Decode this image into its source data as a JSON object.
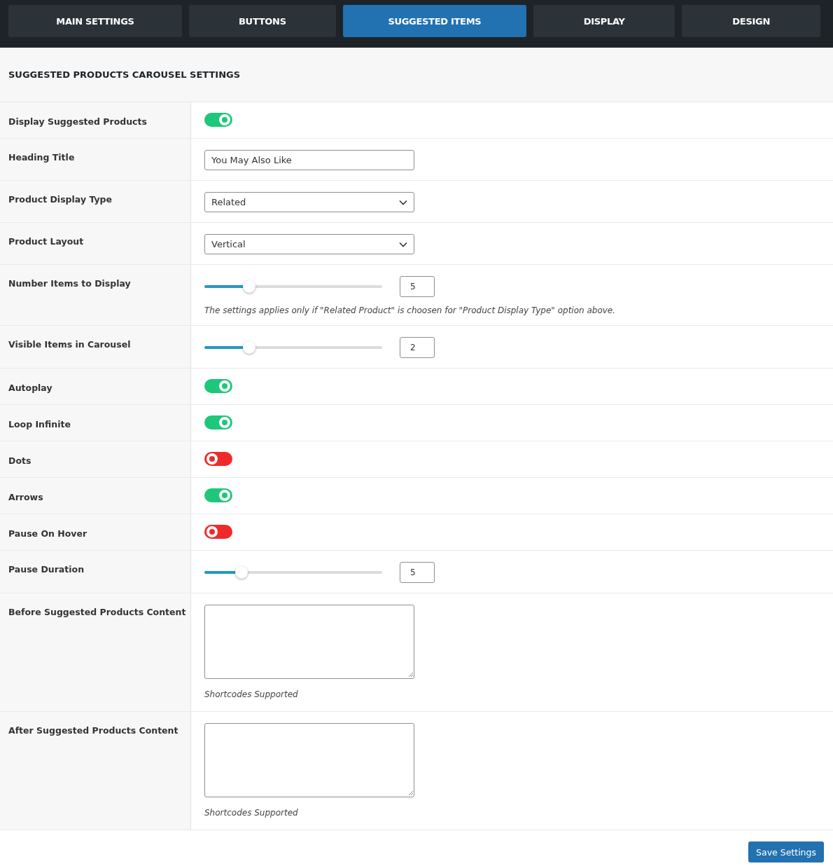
{
  "tabs": [
    {
      "label": "MAIN SETTINGS",
      "selected": false
    },
    {
      "label": "BUTTONS",
      "selected": false
    },
    {
      "label": "SUGGESTED ITEMS",
      "selected": true
    },
    {
      "label": "DISPLAY",
      "selected": false
    },
    {
      "label": "DESIGN",
      "selected": false
    }
  ],
  "section_title": "SUGGESTED PRODUCTS CAROUSEL SETTINGS",
  "settings": [
    {
      "kind": "toggle",
      "label": "Display Suggested Products",
      "on": true
    },
    {
      "kind": "text",
      "label": "Heading Title",
      "value": "You May Also Like"
    },
    {
      "kind": "select",
      "label": "Product Display Type",
      "value": "Related"
    },
    {
      "kind": "select",
      "label": "Product Layout",
      "value": "Vertical"
    },
    {
      "kind": "slider",
      "label": "Number Items to Display",
      "level": 0.25,
      "value": "5",
      "note": "The settings applies only if \"Related Product\" is choosen for \"Product Display Type\" option above."
    },
    {
      "kind": "slider",
      "label": "Visible Items in Carousel",
      "level": 0.25,
      "value": "2"
    },
    {
      "kind": "toggle",
      "label": "Autoplay",
      "on": true
    },
    {
      "kind": "toggle",
      "label": "Loop Infinite",
      "on": true
    },
    {
      "kind": "toggle",
      "label": "Dots",
      "on": false
    },
    {
      "kind": "toggle",
      "label": "Arrows",
      "on": true
    },
    {
      "kind": "toggle",
      "label": "Pause On Hover",
      "on": false
    },
    {
      "kind": "slider",
      "label": "Pause Duration",
      "level": 0.21,
      "value": "5"
    },
    {
      "kind": "textarea",
      "label": "Before Suggested Products Content",
      "note": "Shortcodes Supported"
    },
    {
      "kind": "textarea",
      "label": "After Suggested Products Content",
      "note": "Shortcodes Supported"
    }
  ],
  "save_button": "Save Settings"
}
